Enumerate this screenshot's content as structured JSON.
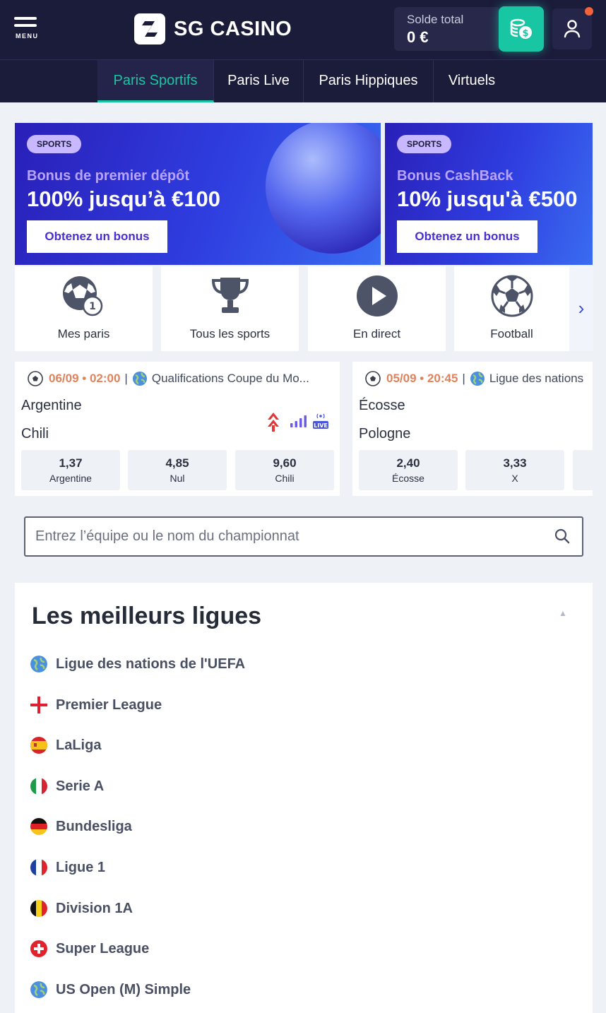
{
  "header": {
    "menu_label": "MENU",
    "logo_text": "SG CASINO",
    "balance_label": "Solde total",
    "balance_value": "0 €"
  },
  "nav": {
    "tabs": [
      {
        "label": "Paris Sportifs",
        "active": true
      },
      {
        "label": "Paris Live",
        "active": false
      },
      {
        "label": "Paris Hippiques",
        "active": false
      },
      {
        "label": "Virtuels",
        "active": false
      }
    ]
  },
  "banners": [
    {
      "tag": "SPORTS",
      "subtitle": "Bonus de premier dépôt",
      "headline": "100% jusqu’à €100",
      "cta": "Obtenez un bonus"
    },
    {
      "tag": "SPORTS",
      "subtitle": "Bonus CashBack",
      "headline": "10% jusqu'à €500",
      "cta": "Obtenez un bonus"
    }
  ],
  "quick_tiles": [
    {
      "label": "Mes paris",
      "icon": "my-bets-icon",
      "badge": "1"
    },
    {
      "label": "Tous les sports",
      "icon": "trophy-icon"
    },
    {
      "label": "En direct",
      "icon": "play-icon"
    },
    {
      "label": "Football",
      "icon": "football-icon"
    }
  ],
  "matches": [
    {
      "datetime": "06/09 • 02:00",
      "competition": "Qualifications Coupe du Mo...",
      "home": "Argentine",
      "away": "Chili",
      "live_badge": "LIVE",
      "odds": [
        {
          "value": "1,37",
          "label": "Argentine"
        },
        {
          "value": "4,85",
          "label": "Nul"
        },
        {
          "value": "9,60",
          "label": "Chili"
        }
      ]
    },
    {
      "datetime": "05/09 • 20:45",
      "competition": "Ligue des nations",
      "home": "Écosse",
      "away": "Pologne",
      "odds": [
        {
          "value": "2,40",
          "label": "Écosse"
        },
        {
          "value": "3,33",
          "label": "X"
        }
      ]
    }
  ],
  "search": {
    "placeholder": "Entrez l’équipe ou le nom du championnat"
  },
  "top_leagues": {
    "title": "Les meilleurs ligues",
    "items": [
      {
        "name": "Ligue des nations de l'UEFA",
        "flag": "world"
      },
      {
        "name": "Premier League",
        "flag": "england"
      },
      {
        "name": "LaLiga",
        "flag": "spain"
      },
      {
        "name": "Serie A",
        "flag": "italy"
      },
      {
        "name": "Bundesliga",
        "flag": "germany"
      },
      {
        "name": "Ligue 1",
        "flag": "france"
      },
      {
        "name": "Division 1A",
        "flag": "belgium"
      },
      {
        "name": "Super League",
        "flag": "switzerland"
      },
      {
        "name": "US Open (M) Simple",
        "flag": "world"
      }
    ]
  },
  "colors": {
    "header_bg": "#1b1b3a",
    "accent_teal": "#19c6a4",
    "banner_purple": "#2f3ee0",
    "date_orange": "#e0835c"
  }
}
